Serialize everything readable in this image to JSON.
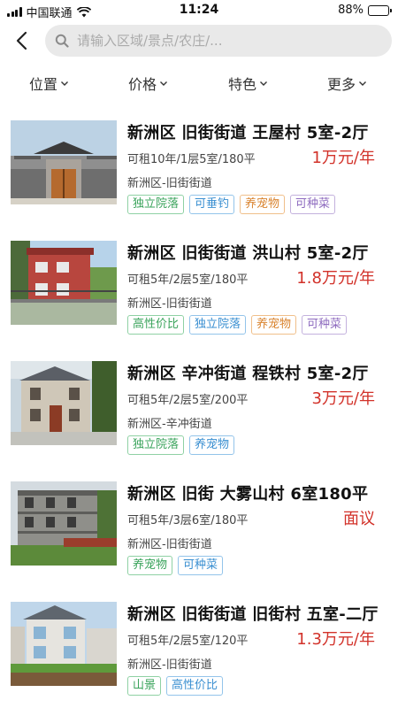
{
  "status_bar": {
    "carrier": "中国联通",
    "time": "11:24",
    "battery": "88%",
    "battery_level": 0.88
  },
  "header": {
    "back_icon": "chevron-left-icon",
    "search_icon": "search-icon",
    "search_placeholder": "请输入区域/景点/农庄/..."
  },
  "filters": [
    {
      "label": "位置"
    },
    {
      "label": "价格"
    },
    {
      "label": "特色"
    },
    {
      "label": "更多"
    }
  ],
  "listings": [
    {
      "title": "新洲区 旧街街道 王屋村 5室-2厅",
      "spec": "可租10年/1层5室/180平",
      "price": "1万元/年",
      "location": "新洲区-旧街街道",
      "tags": [
        "独立院落",
        "可垂钓",
        "养宠物",
        "可种菜"
      ]
    },
    {
      "title": "新洲区 旧街街道 洪山村 5室-2厅",
      "spec": "可租5年/2层5室/180平",
      "price": "1.8万元/年",
      "location": "新洲区-旧街街道",
      "tags": [
        "高性价比",
        "独立院落",
        "养宠物",
        "可种菜"
      ]
    },
    {
      "title": "新洲区 辛冲街道 程铁村 5室-2厅",
      "spec": "可租5年/2层5室/200平",
      "price": "3万元/年",
      "location": "新洲区-辛冲街道",
      "tags": [
        "独立院落",
        "养宠物"
      ]
    },
    {
      "title": "新洲区 旧街 大雾山村 6室180平",
      "spec": "可租5年/3层6室/180平",
      "price": "面议",
      "location": "新洲区-旧街街道",
      "tags": [
        "养宠物",
        "可种菜"
      ]
    },
    {
      "title": "新洲区 旧街街道 旧街村 五室-二厅",
      "spec": "可租5年/2层5室/120平",
      "price": "1.3万元/年",
      "location": "新洲区-旧街街道",
      "tags": [
        "山景",
        "高性价比"
      ]
    }
  ],
  "colors": {
    "price": "#d2322a",
    "search_bg": "#e9e9e9",
    "tag_green": "#3aa35b",
    "tag_blue": "#3a8fd1",
    "tag_orange": "#d9832e",
    "tag_purple": "#8e6bbf"
  }
}
